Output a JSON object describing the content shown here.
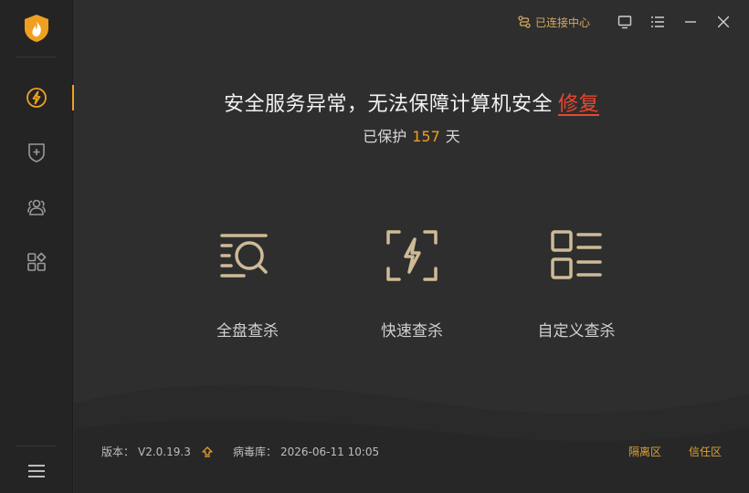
{
  "top": {
    "connection_status": "已连接中心"
  },
  "headline": {
    "warning": "安全服务异常，无法保障计算机安全",
    "repair_link": "修复"
  },
  "protection": {
    "prefix": "已保护",
    "days": "157",
    "suffix": "天"
  },
  "scans": [
    {
      "label": "全盘查杀",
      "icon": "full-scan-icon"
    },
    {
      "label": "快速查杀",
      "icon": "quick-scan-icon"
    },
    {
      "label": "自定义查杀",
      "icon": "custom-scan-icon"
    }
  ],
  "sidebar": {
    "items": [
      {
        "icon": "lightning-icon",
        "active": true
      },
      {
        "icon": "shield-plus-icon",
        "active": false
      },
      {
        "icon": "users-icon",
        "active": false
      },
      {
        "icon": "apps-icon",
        "active": false
      }
    ]
  },
  "footer": {
    "version_label": "版本：",
    "version": "V2.0.19.3",
    "virus_db_label": "病毒库：",
    "virus_db_date": "2026-06-11 10:05",
    "quarantine": "隔离区",
    "trust": "信任区"
  },
  "colors": {
    "accent": "#f0a020",
    "warning": "#e8472e",
    "icon_gold": "#cdbb96"
  }
}
